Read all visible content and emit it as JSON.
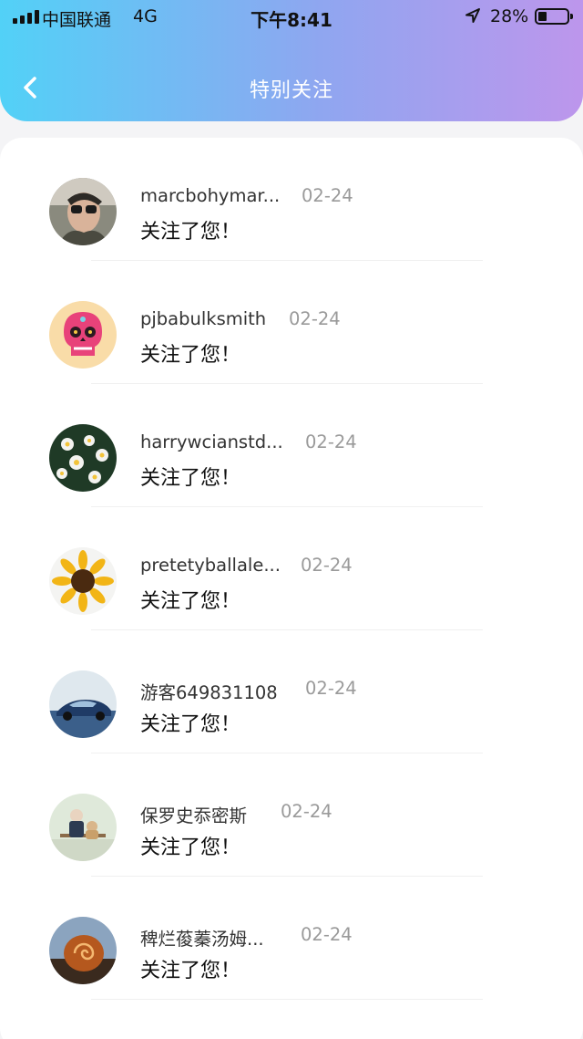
{
  "status_bar": {
    "carrier": "中国联通",
    "network": "4G",
    "time": "下午8:41",
    "battery": "28%",
    "battery_level": 0.28
  },
  "header": {
    "title": "特别关注",
    "back_icon": "chevron-left-icon"
  },
  "notifications": [
    {
      "name": "marcbohymar...",
      "date": "02-24",
      "message": "关注了您！"
    },
    {
      "name": "pjbabulksmith",
      "date": "02-24",
      "message": "关注了您！"
    },
    {
      "name": "harrywcianstd...",
      "date": "02-24",
      "message": "关注了您！"
    },
    {
      "name": "pretetyballale...",
      "date": "02-24",
      "message": "关注了您！"
    },
    {
      "name": "游客649831108",
      "date": "02-24",
      "message": "关注了您！"
    },
    {
      "name": "保罗史忝密斯",
      "date": "02-24",
      "message": "关注了您！"
    },
    {
      "name": "稗烂葰蓁汤姆...",
      "date": "02-24",
      "message": "关注了您！"
    }
  ]
}
